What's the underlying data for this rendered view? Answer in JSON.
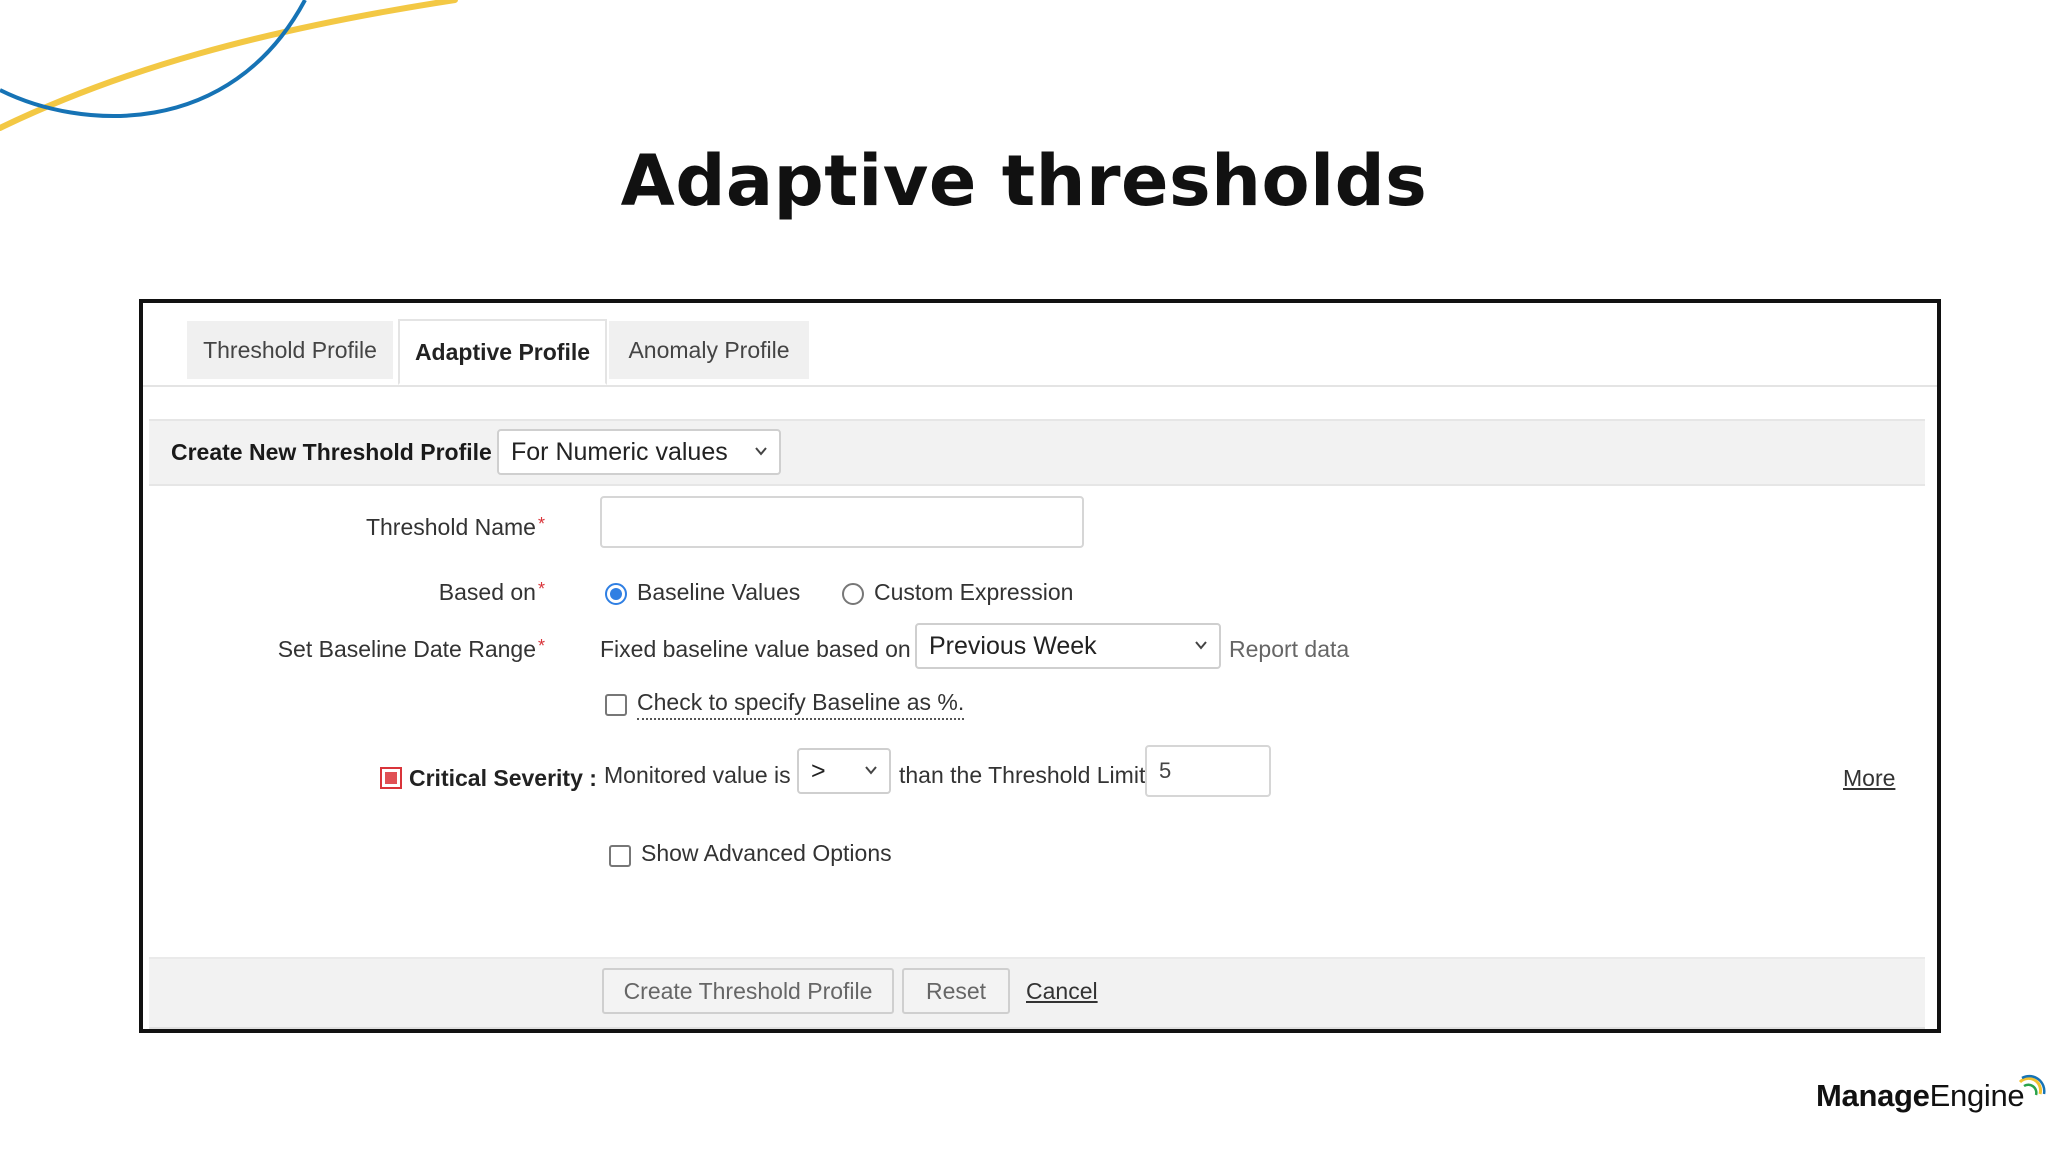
{
  "slide": {
    "title": "Adaptive thresholds"
  },
  "tabs": [
    "Threshold Profile",
    "Adaptive Profile",
    "Anomaly Profile"
  ],
  "active_tab": "Adaptive Profile",
  "header": {
    "label": "Create New Threshold Profile",
    "type_select": "For Numeric values"
  },
  "form": {
    "threshold_name": {
      "label": "Threshold Name",
      "required_mark": "*",
      "value": ""
    },
    "based_on": {
      "label": "Based on",
      "required_mark": "*",
      "options": [
        "Baseline Values",
        "Custom Expression"
      ],
      "selected": "Baseline Values"
    },
    "baseline_range": {
      "label": "Set Baseline Date Range",
      "required_mark": "*",
      "prefix": "Fixed baseline value based on",
      "select": "Previous Week",
      "suffix": "Report data"
    },
    "baseline_percent_checkbox": {
      "label": "Check to specify Baseline as %.",
      "checked": false
    },
    "critical": {
      "label": "Critical Severity :",
      "prefix": "Monitored value is",
      "operator": ">",
      "middle": "than the Threshold Limit",
      "limit": "5",
      "more": "More"
    },
    "advanced_checkbox": {
      "label": "Show Advanced Options",
      "checked": false
    }
  },
  "buttons": {
    "create": "Create Threshold Profile",
    "reset": "Reset",
    "cancel": "Cancel"
  },
  "brand": {
    "name_bold": "Manage",
    "name_regular": "Engine"
  },
  "colors": {
    "radio_accent": "#2f7fe3",
    "required": "#d9343a",
    "swoosh_blue": "#1673b5",
    "swoosh_yellow": "#f2c230"
  }
}
